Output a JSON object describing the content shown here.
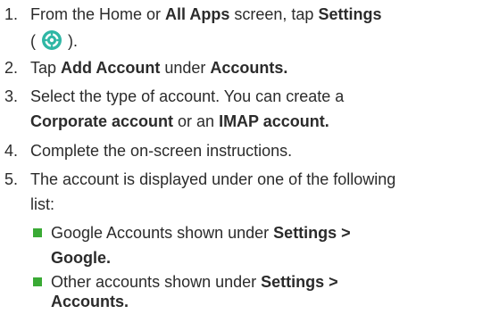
{
  "steps": [
    {
      "num": "1.",
      "line1": {
        "pre": "From the Home or ",
        "b1": "All Apps",
        "mid": " screen, tap ",
        "b2": "Settings"
      },
      "line2": {
        "open": "( ",
        "close": " )."
      }
    },
    {
      "num": "2.",
      "line1": {
        "pre": "Tap ",
        "b1": "Add Account",
        "mid": " under ",
        "b2": "Accounts."
      }
    },
    {
      "num": "3.",
      "line1": {
        "text": "Select the type of account. You can create a"
      },
      "line2": {
        "b1": "Corporate account",
        "mid": " or an ",
        "b2": "IMAP account."
      }
    },
    {
      "num": "4.",
      "line1": {
        "text": "Complete the on-screen instructions."
      }
    },
    {
      "num": "5.",
      "line1": {
        "text": "The account is displayed under one of the following"
      },
      "line2": {
        "text": "list:"
      }
    }
  ],
  "bullets": [
    {
      "pre": "Google Accounts shown under ",
      "b1": "Settings >",
      "b2": "Google."
    },
    {
      "pre": "Other accounts shown under ",
      "b1": "Settings >",
      "b2": "Accounts."
    }
  ],
  "icons": {
    "settings": "gear-icon"
  },
  "colors": {
    "bullet": "#3aaa35",
    "icon_bg": "#2fb7a5",
    "text": "#2b2b2b"
  }
}
